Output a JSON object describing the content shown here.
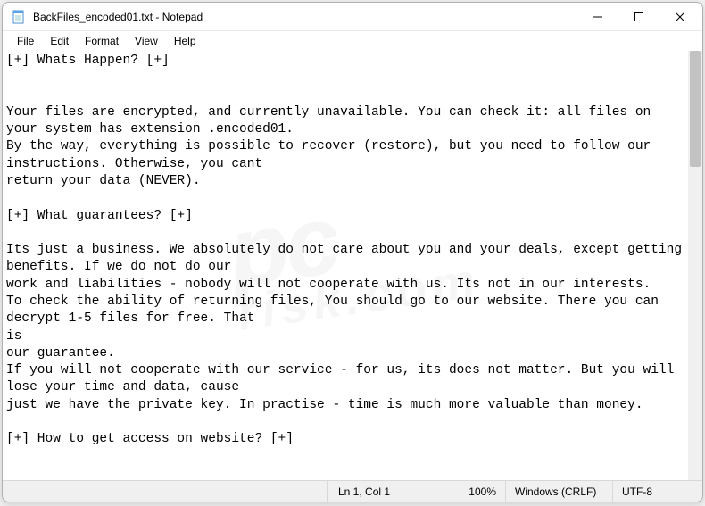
{
  "title": "BackFiles_encoded01.txt - Notepad",
  "menu": {
    "file": "File",
    "edit": "Edit",
    "format": "Format",
    "view": "View",
    "help": "Help"
  },
  "content": "[+] Whats Happen? [+]\n\n\nYour files are encrypted, and currently unavailable. You can check it: all files on your system has extension .encoded01.\nBy the way, everything is possible to recover (restore), but you need to follow our instructions. Otherwise, you cant\nreturn your data (NEVER).\n\n[+] What guarantees? [+]\n\nIts just a business. We absolutely do not care about you and your deals, except getting benefits. If we do not do our\nwork and liabilities - nobody will not cooperate with us. Its not in our interests.\nTo check the ability of returning files, You should go to our website. There you can decrypt 1-5 files for free. That\nis\nour guarantee.\nIf you will not cooperate with our service - for us, its does not matter. But you will lose your time and data, cause\njust we have the private key. In practise - time is much more valuable than money.\n\n[+] How to get access on website? [+]",
  "status": {
    "lncol": "Ln 1, Col 1",
    "zoom": "100%",
    "eol": "Windows (CRLF)",
    "encoding": "UTF-8"
  },
  "watermark": {
    "main": "pc",
    "sub": "risk.com"
  }
}
